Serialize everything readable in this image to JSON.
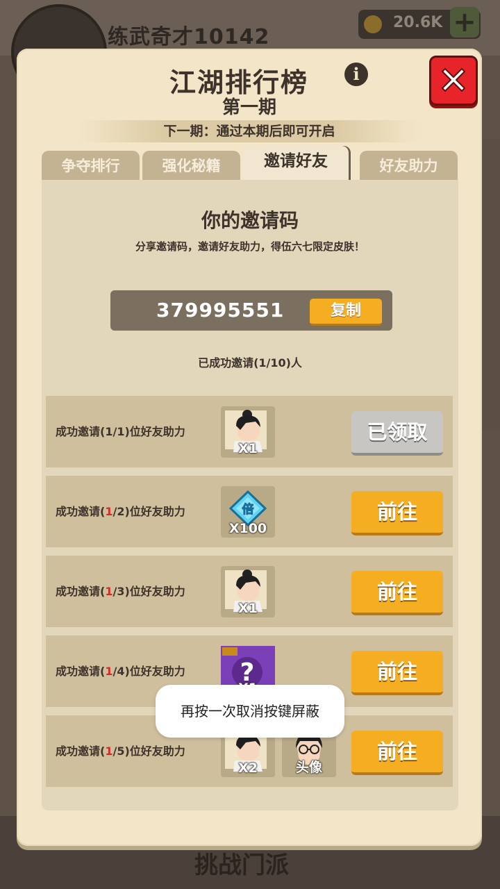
{
  "background": {
    "player_name": "练武奇才10142",
    "currency_amount": "20.6K",
    "bottom_label": "挑战门派"
  },
  "panel": {
    "title": "江湖排行榜",
    "subtitle": "第一期",
    "next_period": "下一期：通过本期后即可开启",
    "icons": {
      "info": "info-icon",
      "close": "close-icon"
    }
  },
  "tabs": [
    {
      "label": "争夺排行",
      "active": false
    },
    {
      "label": "强化秘籍",
      "active": false
    },
    {
      "label": "邀请好友",
      "active": true
    },
    {
      "label": "好友助力",
      "active": false
    }
  ],
  "invite": {
    "title": "你的邀请码",
    "description": "分享邀请码，邀请好友助力，得伍六七限定皮肤！",
    "code": "379995551",
    "copy_label": "复制",
    "invite_count_text": "已成功邀请(1/10)人"
  },
  "rewards": [
    {
      "prefix": "成功邀请(",
      "current": "1",
      "suffix": "/1)位好友助力",
      "current_highlight": false,
      "items": [
        {
          "icon": "character-avatar-icon",
          "qty": "X1"
        }
      ],
      "button": "已领取",
      "claimed": true
    },
    {
      "prefix": "成功邀请(",
      "current": "1",
      "suffix": "/2)位好友助力",
      "current_highlight": true,
      "items": [
        {
          "icon": "blue-diamond-icon",
          "qty": "X100"
        }
      ],
      "button": "前往",
      "claimed": false
    },
    {
      "prefix": "成功邀请(",
      "current": "1",
      "suffix": "/3)位好友助力",
      "current_highlight": true,
      "items": [
        {
          "icon": "character-avatar-icon",
          "qty": "X1"
        }
      ],
      "button": "前往",
      "claimed": false
    },
    {
      "prefix": "成功邀请(",
      "current": "1",
      "suffix": "/4)位好友助力",
      "current_highlight": true,
      "items": [
        {
          "icon": "mystery-box-icon",
          "qty": "X1"
        }
      ],
      "button": "前往",
      "claimed": false
    },
    {
      "prefix": "成功邀请(",
      "current": "1",
      "suffix": "/5)位好友助力",
      "current_highlight": true,
      "items": [
        {
          "icon": "character-avatar-icon",
          "qty": "X2"
        },
        {
          "icon": "portrait-icon",
          "qty": "头像"
        }
      ],
      "button": "前往",
      "claimed": false
    }
  ],
  "toast": "再按一次取消按键屏蔽",
  "colors": {
    "button_orange": "#f5ae21",
    "highlight_red": "#d42a2a",
    "close_red": "#e8242b"
  }
}
